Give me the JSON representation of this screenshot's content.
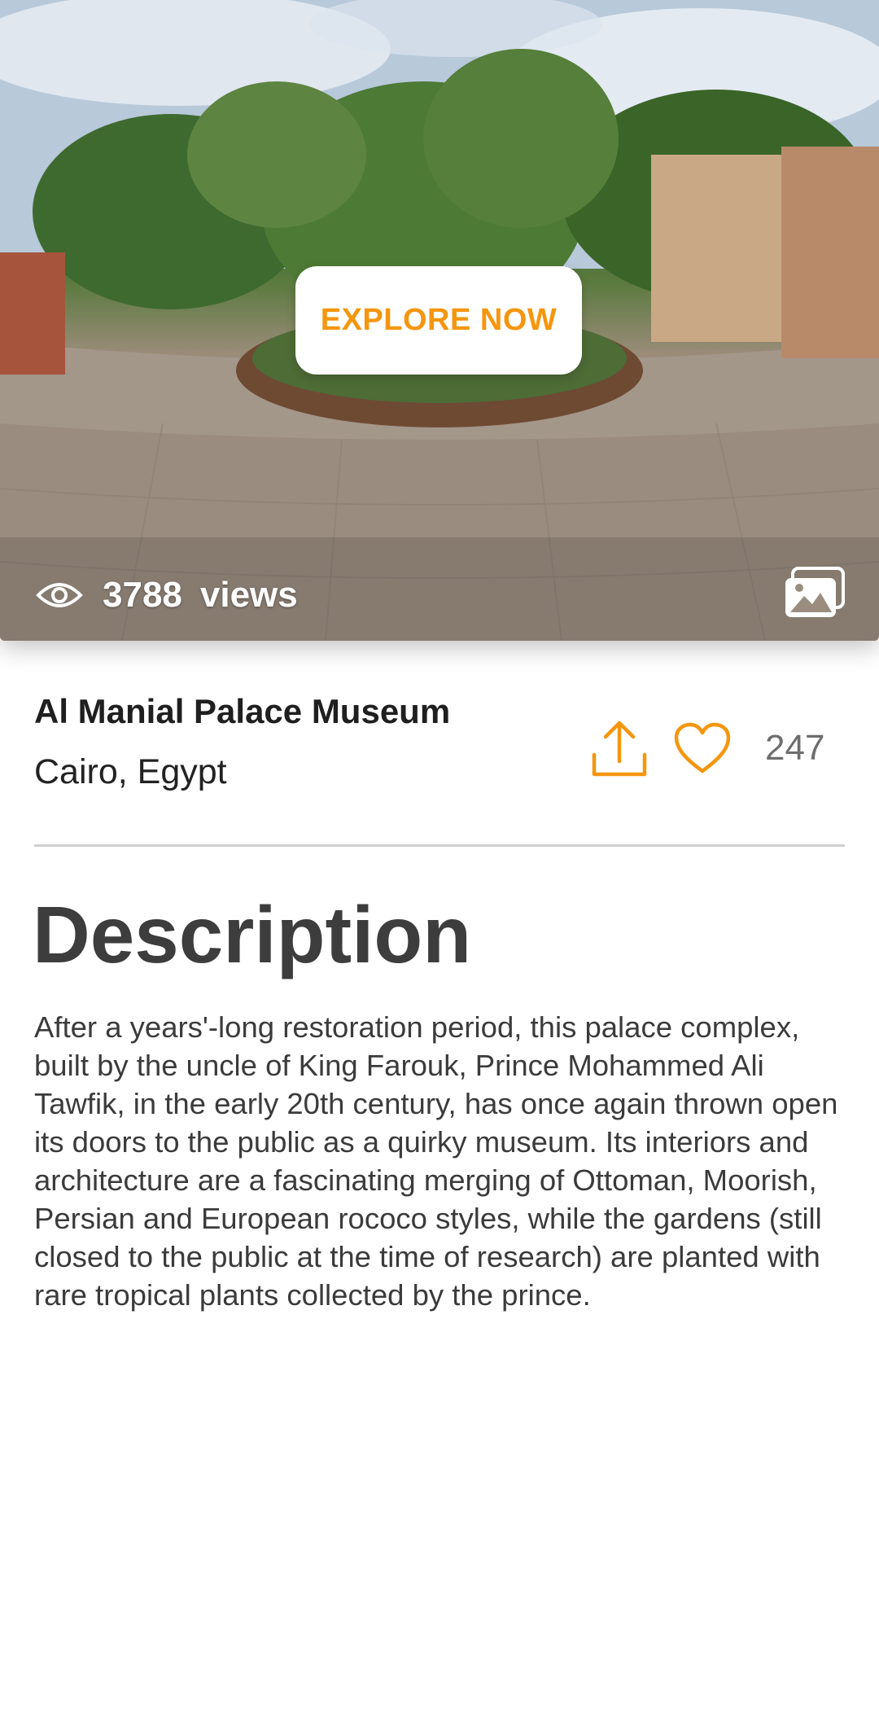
{
  "hero": {
    "explore_label": "EXPLORE NOW",
    "views_count": "3788",
    "views_label": "views",
    "icons": [
      "eye-icon",
      "gallery-icon"
    ]
  },
  "place": {
    "name": "Al Manial Palace Museum",
    "location": "Cairo, Egypt",
    "likes": "247",
    "icons": [
      "share-icon",
      "heart-icon"
    ]
  },
  "description": {
    "title": "Description",
    "body": "After a years'-long restoration period, this palace complex, built by the uncle of King Farouk, Prince Mohammed Ali Tawfik, in the early 20th century, has once again thrown open its doors to the public as a quirky museum. Its interiors and architecture are a fascinating merging of Ottoman, Moorish, Persian and European rococo styles, while the gardens (still closed to the public at the time of research) are planted with rare tropical plants collected by the prince."
  },
  "colors": {
    "accent": "#f5960f",
    "title_text": "#3d3d3d",
    "divider": "#d0d0d0"
  }
}
